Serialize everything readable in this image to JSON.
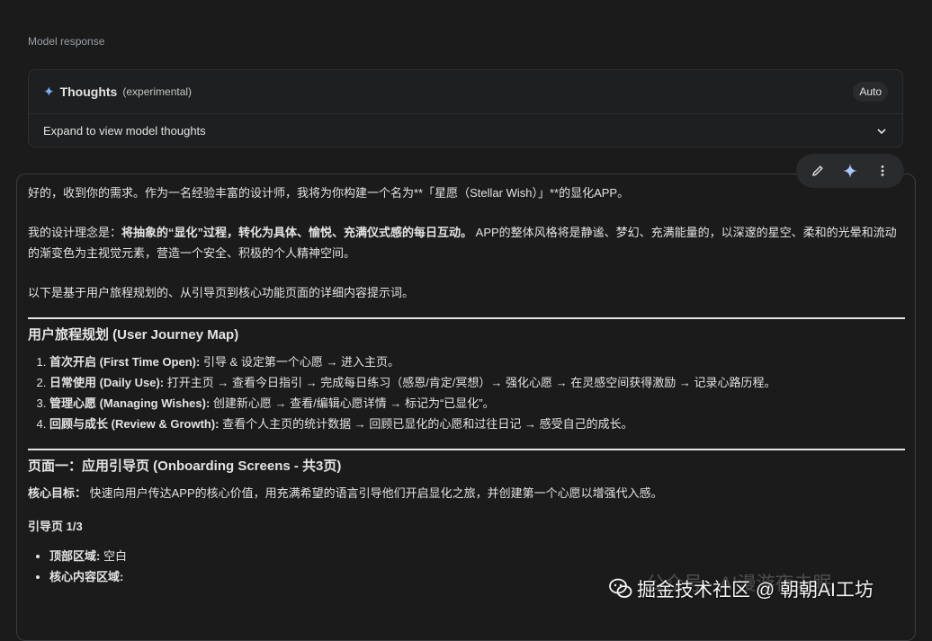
{
  "section_label": "Model response",
  "thoughts": {
    "title": "Thoughts",
    "subtitle": "(experimental)",
    "badge": "Auto",
    "expand_text": "Expand to view model thoughts",
    "icon": "sparkle-icon"
  },
  "toolbar": {
    "icons": [
      "edit-pencil-icon",
      "sparkle-icon",
      "more-vert-icon"
    ]
  },
  "response": {
    "p1": "好的，收到你的需求。作为一名经验丰富的设计师，我将为你构建一个名为**「星愿（Stellar Wish）」**的显化APP。",
    "p2_prefix": "我的设计理念是：",
    "p2_bold": "将抽象的“显化”过程，转化为具体、愉悦、充满仪式感的每日互动。",
    "p2_rest": " APP的整体风格将是静谧、梦幻、充满能量的，以深邃的星空、柔和的光晕和流动的渐变色为主视觉元素，营造一个安全、积极的个人精神空间。",
    "p3": "以下是基于用户旅程规划的、从引导页到核心功能页面的详细内容提示词。",
    "journey_heading": "用户旅程规划 (User Journey Map)",
    "journey_items": [
      {
        "bold": "首次开启 (First Time Open):",
        "text": " 引导 & 设定第一个心愿 → 进入主页。"
      },
      {
        "bold": "日常使用 (Daily Use):",
        "text": " 打开主页 → 查看今日指引 → 完成每日练习（感恩/肯定/冥想）→ 强化心愿 → 在灵感空间获得激励 → 记录心路历程。"
      },
      {
        "bold": "管理心愿 (Managing Wishes):",
        "text": " 创建新心愿 → 查看/编辑心愿详情 → 标记为“已显化”。"
      },
      {
        "bold": "回顾与成长 (Review & Growth):",
        "text": " 查看个人主页的统计数据 → 回顾已显化的心愿和过往日记 → 感受自己的成长。"
      }
    ],
    "page1_heading": "页面一：应用引导页 (Onboarding Screens - 共3页)",
    "goal_label": "核心目标：",
    "goal_text": " 快速向用户传达APP的核心价值，用充满希望的语言引导他们开启显化之旅，并创建第一个心愿以增强代入感。",
    "sub_heading": "引导页 1/3",
    "bullets": [
      {
        "bold": "顶部区域:",
        "text": " 空白"
      },
      {
        "bold": "核心内容区域:",
        "text": ""
      }
    ]
  },
  "watermark": {
    "faint": "公众号 · AI漫游夜未眠",
    "main": "掘金技术社区 @ 朝朝AI工坊"
  }
}
